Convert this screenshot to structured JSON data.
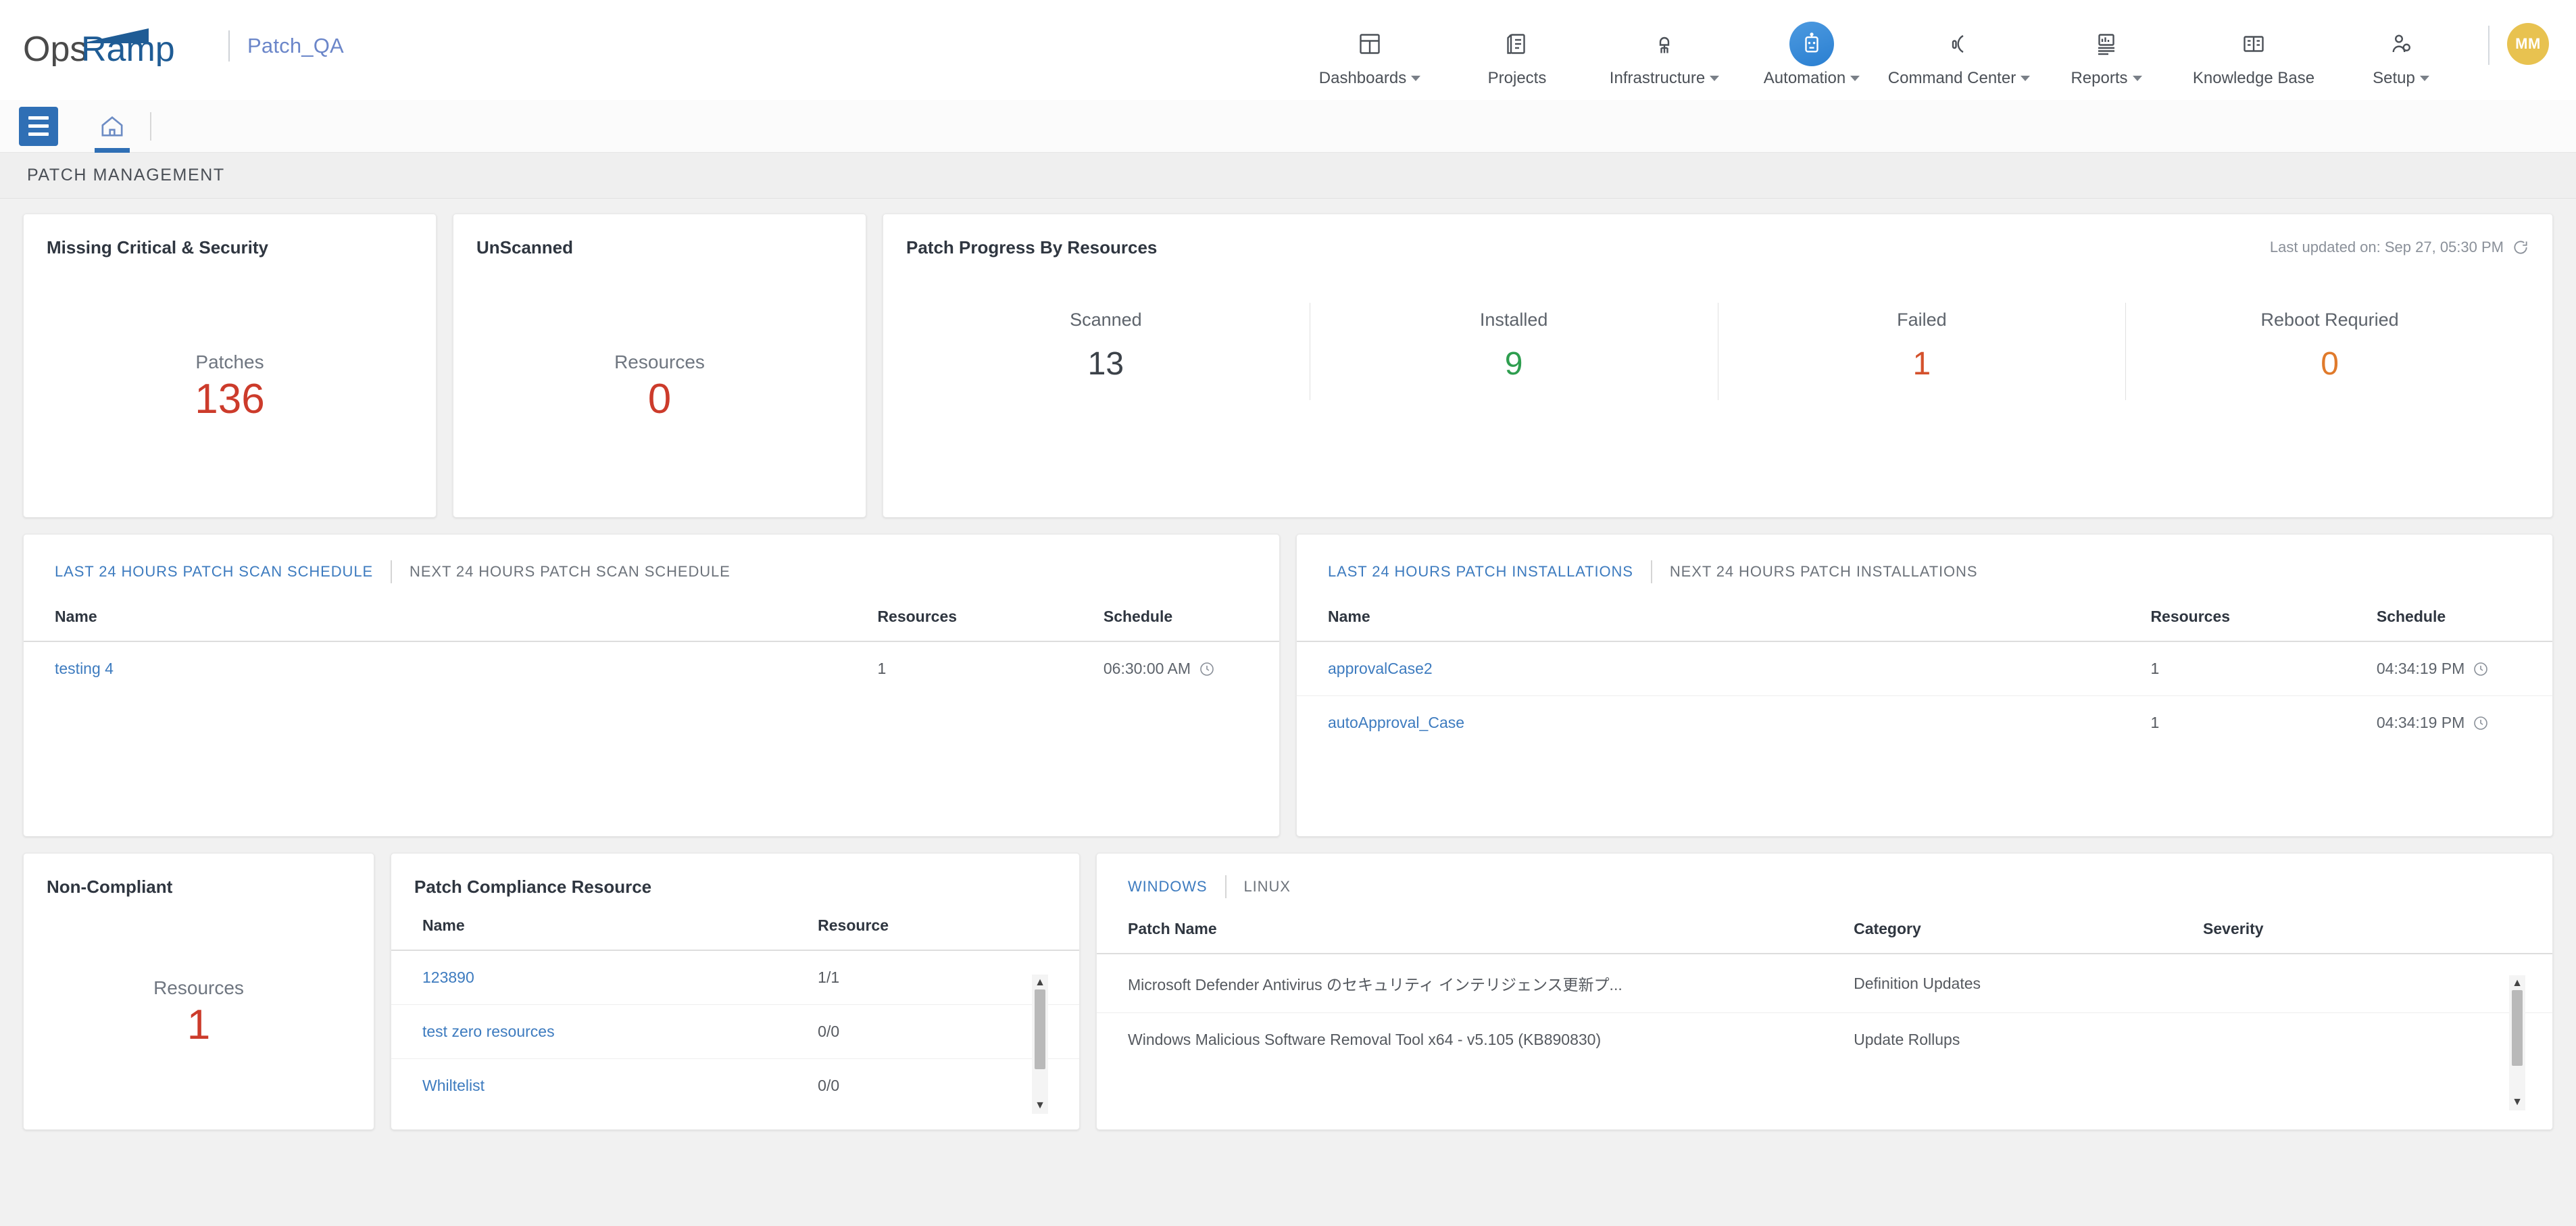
{
  "brand": {
    "name": "OpsRamp",
    "tenant": "Patch_QA"
  },
  "topnav": {
    "items": [
      {
        "label": "Dashboards",
        "icon": "dashboard-icon",
        "caret": true,
        "active": false
      },
      {
        "label": "Projects",
        "icon": "projects-icon",
        "caret": false,
        "active": false
      },
      {
        "label": "Infrastructure",
        "icon": "infrastructure-icon",
        "caret": true,
        "active": false
      },
      {
        "label": "Automation",
        "icon": "robot-icon",
        "caret": true,
        "active": true
      },
      {
        "label": "Command Center",
        "icon": "headset-icon",
        "caret": true,
        "active": false
      },
      {
        "label": "Reports",
        "icon": "reports-icon",
        "caret": true,
        "active": false
      },
      {
        "label": "Knowledge Base",
        "icon": "book-icon",
        "caret": false,
        "active": false
      },
      {
        "label": "Setup",
        "icon": "user-gear-icon",
        "caret": true,
        "active": false
      }
    ],
    "avatar_initials": "MM"
  },
  "subbar": {
    "menu_icon": "hamburger-icon",
    "home_icon": "home-icon"
  },
  "page_title": "PATCH MANAGEMENT",
  "kpi_missing": {
    "title": "Missing Critical & Security",
    "label": "Patches",
    "value": "136",
    "color": "#cc3b2b"
  },
  "kpi_unscanned": {
    "title": "UnScanned",
    "label": "Resources",
    "value": "0",
    "color": "#cc3b2b"
  },
  "progress": {
    "title": "Patch Progress By Resources",
    "last_updated": "Last updated on: Sep 27, 05:30 PM",
    "columns": [
      {
        "label": "Scanned",
        "value": "13",
        "color": "#3c4249"
      },
      {
        "label": "Installed",
        "value": "9",
        "color": "#2e9e4f"
      },
      {
        "label": "Failed",
        "value": "1",
        "color": "#d4512c"
      },
      {
        "label": "Reboot Requried",
        "value": "0",
        "color": "#e07a2b"
      }
    ]
  },
  "scan_schedule": {
    "tabs": [
      {
        "label": "LAST 24 HOURS PATCH SCAN SCHEDULE",
        "active": true
      },
      {
        "label": "NEXT 24 HOURS PATCH SCAN SCHEDULE",
        "active": false
      }
    ],
    "headers": [
      "Name",
      "Resources",
      "Schedule"
    ],
    "rows": [
      {
        "name": "testing 4",
        "resources": "1",
        "schedule": "06:30:00 AM"
      }
    ]
  },
  "installations": {
    "tabs": [
      {
        "label": "LAST 24 HOURS PATCH INSTALLATIONS",
        "active": true
      },
      {
        "label": "NEXT 24 HOURS PATCH INSTALLATIONS",
        "active": false
      }
    ],
    "headers": [
      "Name",
      "Resources",
      "Schedule"
    ],
    "rows": [
      {
        "name": "approvalCase2",
        "resources": "1",
        "schedule": "04:34:19 PM"
      },
      {
        "name": "autoApproval_Case",
        "resources": "1",
        "schedule": "04:34:19 PM"
      }
    ]
  },
  "non_compliant": {
    "title": "Non-Compliant",
    "label": "Resources",
    "value": "1",
    "color": "#cc3b2b"
  },
  "compliance_resource": {
    "title": "Patch Compliance Resource",
    "headers": [
      "Name",
      "Resource"
    ],
    "rows": [
      {
        "name": "123890",
        "resource": "1/1"
      },
      {
        "name": "test zero resources",
        "resource": "0/0"
      },
      {
        "name": "Whiltelist",
        "resource": "0/0"
      }
    ]
  },
  "os_patches": {
    "tabs": [
      {
        "label": "WINDOWS",
        "active": true
      },
      {
        "label": "LINUX",
        "active": false
      }
    ],
    "headers": [
      "Patch Name",
      "Category",
      "Severity"
    ],
    "rows": [
      {
        "patch_name": "Microsoft Defender Antivirus のセキュリティ インテリジェンス更新プ...",
        "category": "Definition Updates",
        "severity": ""
      },
      {
        "patch_name": "Windows Malicious Software Removal Tool x64 - v5.105 (KB890830)",
        "category": "Update Rollups",
        "severity": ""
      }
    ]
  }
}
